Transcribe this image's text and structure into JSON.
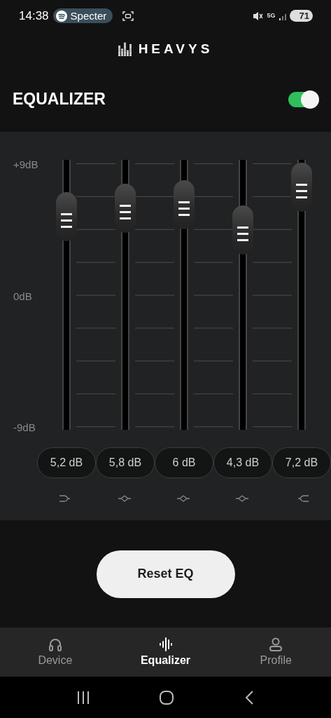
{
  "status_bar": {
    "time": "14:38",
    "media_chip": "Specter",
    "network": "5G",
    "battery": "71"
  },
  "brand": "HEAVYS",
  "header": {
    "title": "EQUALIZER",
    "on": true
  },
  "scale_labels": [
    "+9dB",
    "0dB",
    "-9dB"
  ],
  "bands": [
    {
      "level": 0.789,
      "reading": "5,2 dB",
      "kind": "low_shelf"
    },
    {
      "level": 0.822,
      "reading": "5,8 dB",
      "kind": "peak"
    },
    {
      "level": 0.833,
      "reading": "6 dB",
      "kind": "peak"
    },
    {
      "level": 0.739,
      "reading": "4,3 dB",
      "kind": "peak"
    },
    {
      "level": 0.9,
      "reading": "7,2 dB",
      "kind": "high_shelf"
    }
  ],
  "reset_button": "Reset EQ",
  "nav": [
    {
      "label": "Device",
      "kind": "headphones",
      "selected": false
    },
    {
      "label": "Equalizer",
      "kind": "waveform",
      "selected": true
    },
    {
      "label": "Profile",
      "kind": "person",
      "selected": false
    }
  ]
}
